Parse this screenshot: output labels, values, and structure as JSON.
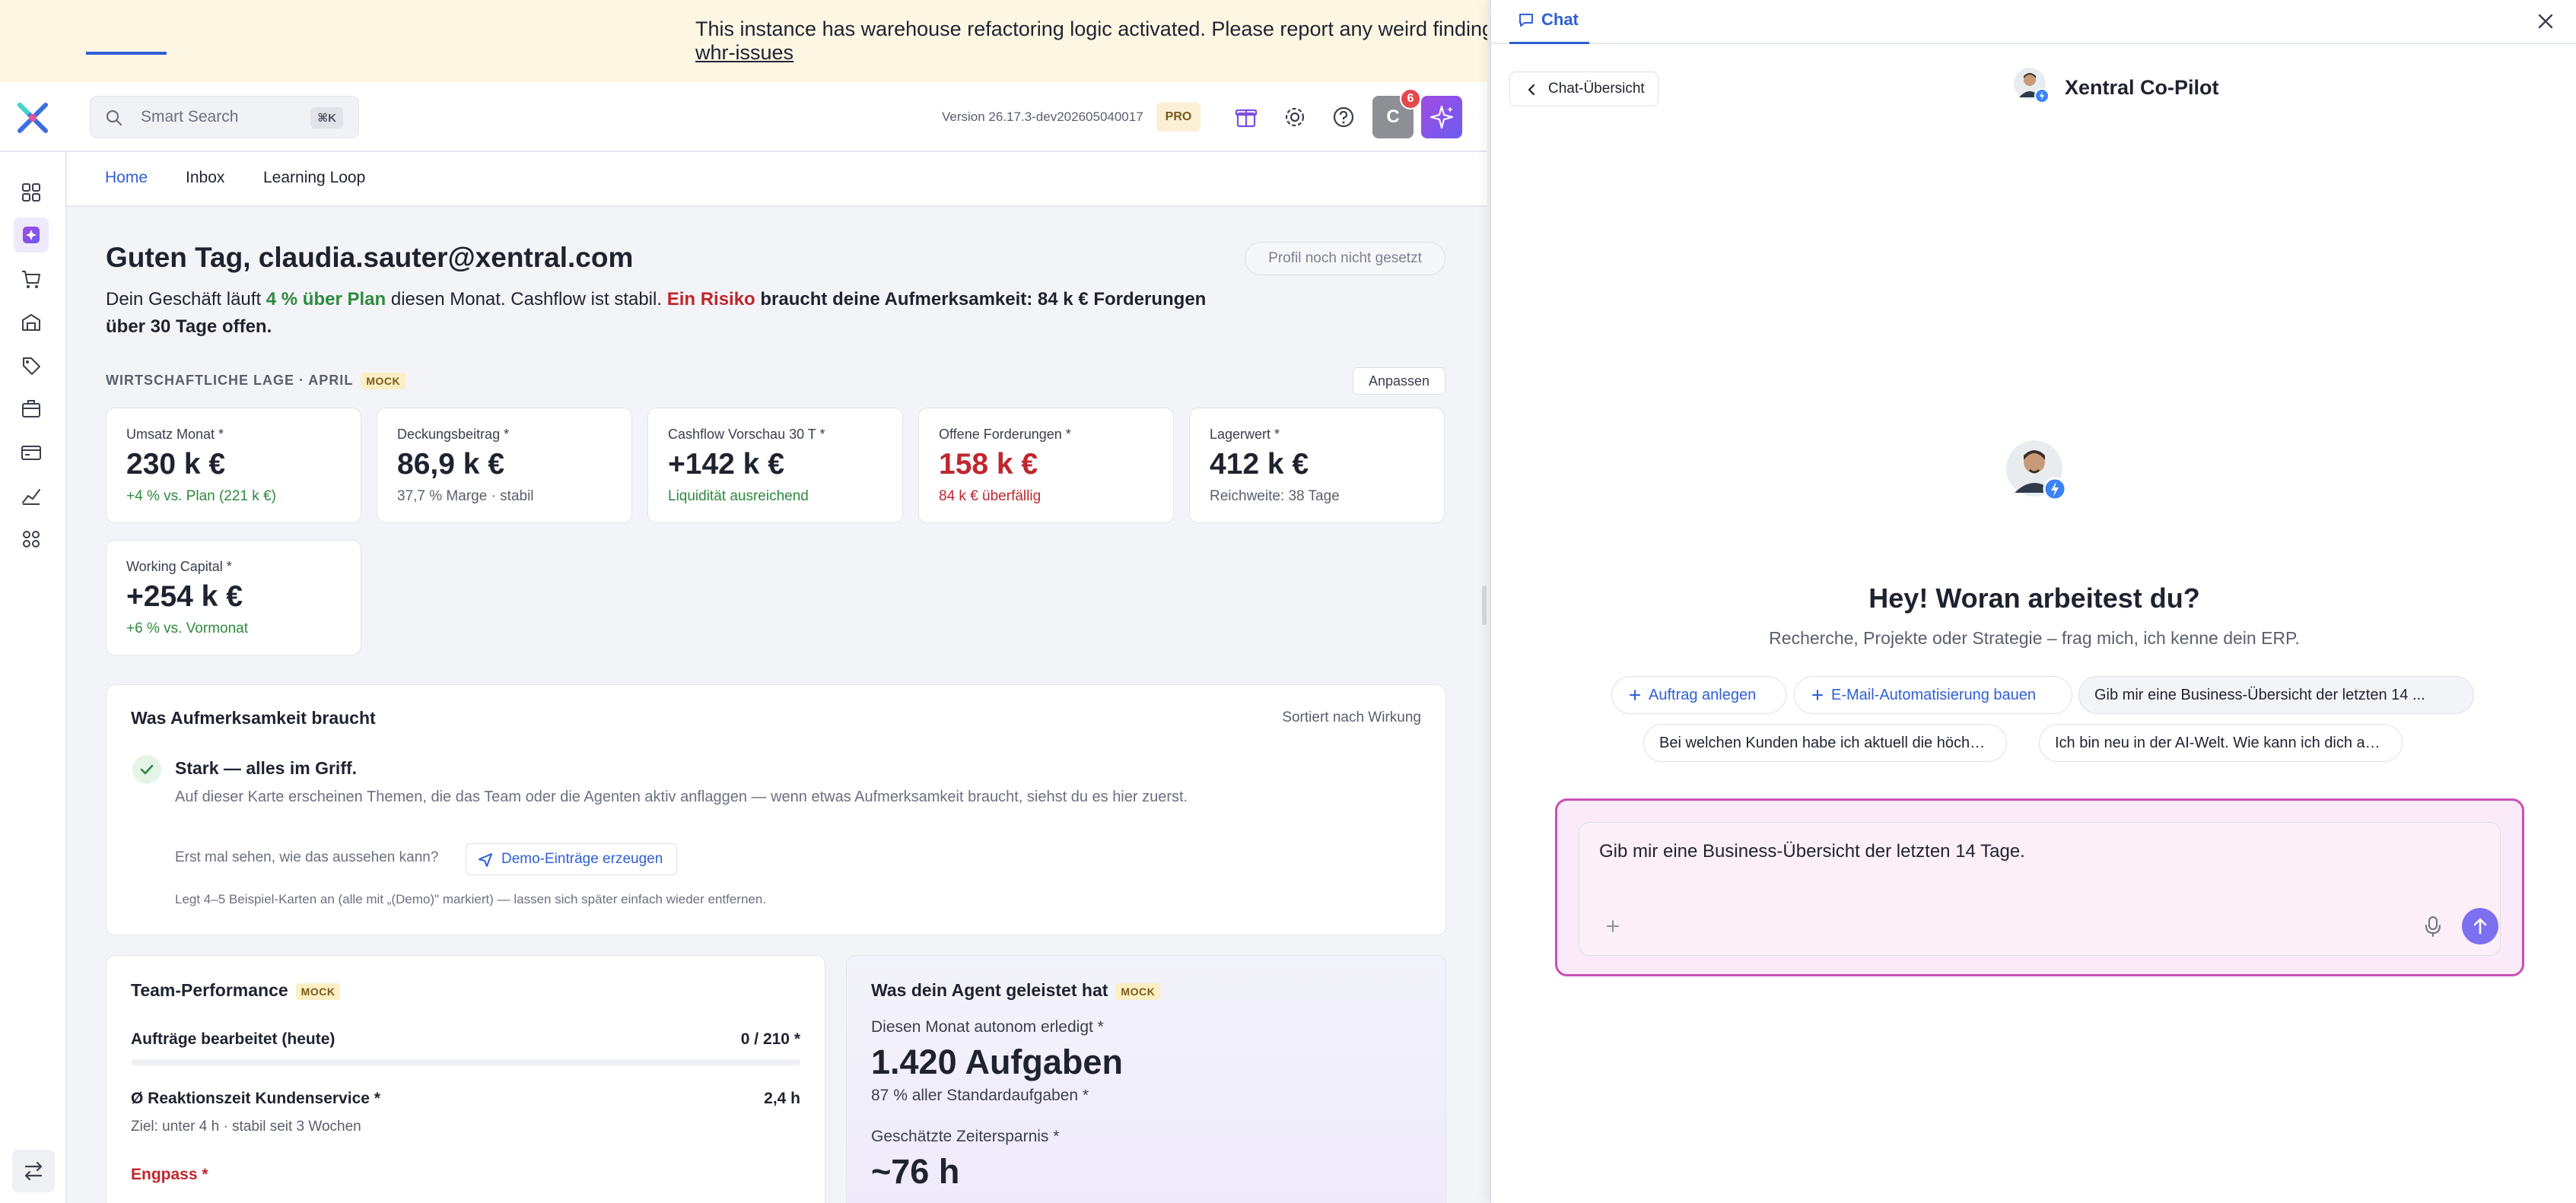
{
  "banner": {
    "line1": "This instance has warehouse refactoring logic activated. Please report any weird findings i",
    "link": "whr-issues"
  },
  "topbar": {
    "search_placeholder": "Smart Search",
    "search_shortcut": "⌘K",
    "version": "Version 26.17.3-dev202605040017",
    "plan_badge": "PRO",
    "user_initial": "C",
    "notifications_count": "6",
    "icons": [
      "gift-icon",
      "gear-icon",
      "help-icon"
    ]
  },
  "sidebar": {
    "items": [
      "dashboard-icon",
      "copilot-icon",
      "cart-icon",
      "warehouse-icon",
      "tag-icon",
      "box-icon",
      "payments-icon",
      "analytics-icon",
      "apps-icon"
    ],
    "active_index": 1
  },
  "tabs": [
    {
      "label": "Home",
      "active": true
    },
    {
      "label": "Inbox",
      "active": false
    },
    {
      "label": "Learning Loop",
      "active": false
    }
  ],
  "home": {
    "greeting": "Guten Tag, claudia.sauter@xentral.com",
    "profile_pill": "Profil noch nicht gesetzt",
    "summary": {
      "part1": "Dein Geschäft läuft ",
      "highlight_green": "4 % über Plan",
      "part2": " diesen Monat. Cashflow ist stabil. ",
      "highlight_red": "Ein Risiko",
      "part3": " braucht deine Aufmerksamkeit: 84 k € Forderungen über 30 Tage offen."
    },
    "section_title": "WIRTSCHAFTLICHE LAGE · APRIL",
    "mock_label": "MOCK",
    "customize_label": "Anpassen",
    "kpis": [
      {
        "label": "Umsatz Monat *",
        "value": "230 k €",
        "sub": "+4 % vs. Plan (221 k €)",
        "value_tone": "normal",
        "sub_tone": "green"
      },
      {
        "label": "Deckungsbeitrag *",
        "value": "86,9 k €",
        "sub": "37,7 % Marge · stabil",
        "value_tone": "normal",
        "sub_tone": "muted"
      },
      {
        "label": "Cashflow Vorschau 30 T *",
        "value": "+142 k €",
        "sub": "Liquidität ausreichend",
        "value_tone": "normal",
        "sub_tone": "green"
      },
      {
        "label": "Offene Forderungen *",
        "value": "158 k €",
        "sub": "84 k € überfällig",
        "value_tone": "red",
        "sub_tone": "red"
      },
      {
        "label": "Lagerwert *",
        "value": "412 k €",
        "sub": "Reichweite: 38 Tage",
        "value_tone": "normal",
        "sub_tone": "muted"
      },
      {
        "label": "Working Capital *",
        "value": "+254 k €",
        "sub": "+6 % vs. Vormonat",
        "value_tone": "normal",
        "sub_tone": "green"
      }
    ],
    "attention": {
      "title": "Was Aufmerksamkeit braucht",
      "sort_label": "Sortiert nach Wirkung",
      "status_title": "Stark — alles im Griff.",
      "status_desc": "Auf dieser Karte erscheinen Themen, die das Team oder die Agenten aktiv anflaggen — wenn etwas Aufmerksamkeit braucht, siehst du es hier zuerst.",
      "question": "Erst mal sehen, wie das aussehen kann?",
      "demo_button": "Demo-Einträge erzeugen",
      "hint": "Legt 4–5 Beispiel-Karten an (alle mit „(Demo)\" markiert) — lassen sich später einfach wieder entfernen."
    },
    "team": {
      "title": "Team-Performance",
      "mock_label": "MOCK",
      "orders_label": "Aufträge bearbeitet (heute)",
      "orders_value": "0 / 210 *",
      "orders_progress": 0,
      "response_label": "Ø Reaktionszeit Kundenservice *",
      "response_value": "2,4 h",
      "response_sub": "Ziel: unter 4 h · stabil seit 3 Wochen",
      "bottleneck_label": "Engpass *"
    },
    "agent": {
      "title": "Was dein Agent geleistet hat",
      "mock_label": "MOCK",
      "l1": "Diesen Monat autonom erledigt *",
      "big1": "1.420 Aufgaben",
      "l2": "87 % aller Standardaufgaben *",
      "l3": "Geschätzte Zeitersparnis *",
      "big2": "~76 h"
    }
  },
  "chat": {
    "tab_label": "Chat",
    "back_label": "Chat-Übersicht",
    "title": "Xentral Co-Pilot",
    "hero_title": "Hey! Woran arbeitest du?",
    "hero_sub": "Recherche, Projekte oder Strategie – frag mich, ich kenne dein ERP.",
    "chips_row1": [
      {
        "label": "Auftrag anlegen",
        "style": "blue"
      },
      {
        "label": "E-Mail-Automatisierung bauen",
        "style": "blue"
      },
      {
        "label": "Gib mir eine Business-Übersicht der letzten 14 ...",
        "style": "grey"
      }
    ],
    "chips_row2": [
      {
        "label": "Bei welchen Kunden habe ich aktuell die höchst...",
        "style": "plain"
      },
      {
        "label": "Ich bin neu in der AI-Welt. Wie kann ich dich am...",
        "style": "plain"
      }
    ],
    "composer_text": "Gib mir eine Business-Übersicht der letzten 14 Tage."
  },
  "colors": {
    "accent": "#2f5fd6",
    "positive": "#2e8a3e",
    "negative": "#c0262d",
    "copilot_gradient_start": "#a24be0",
    "copilot_gradient_end": "#6b5cf2",
    "composer_border": "#c94fb6"
  }
}
